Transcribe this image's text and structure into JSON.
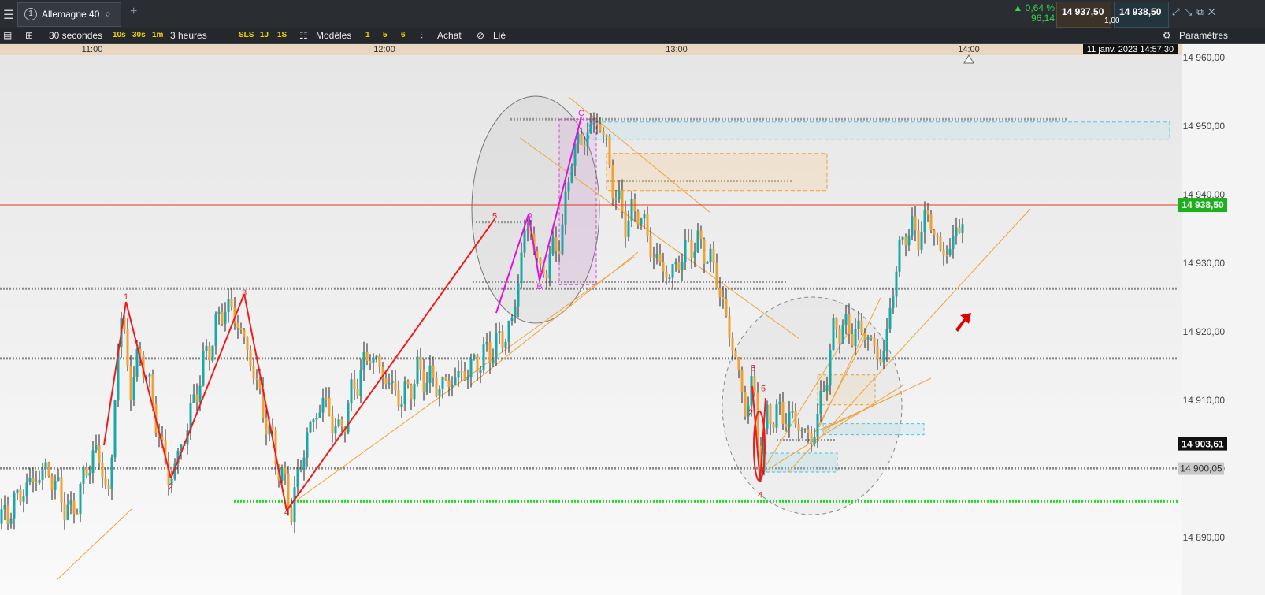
{
  "topbar": {
    "instrument": "Allemagne 40",
    "tab_number": "1",
    "change_pct": "0,64 %",
    "change_abs": "96,14",
    "bid": "14 937,50",
    "ask": "14 938,50",
    "spread": "1,00",
    "accent_green": "#35d24a"
  },
  "toolbar": {
    "interval": "30 secondes",
    "quick_intervals": [
      "10s",
      "30s",
      "1m"
    ],
    "range": "3 heures",
    "range_buttons": [
      "SLS",
      "1J",
      "1S"
    ],
    "templates_label": "Modèles",
    "template_slots": [
      "1",
      "5",
      "6"
    ],
    "buy_label": "Achat",
    "linked_label": "Lié",
    "settings_label": "Paramètres"
  },
  "chart_data": {
    "type": "candlestick",
    "instrument": "Allemagne 40",
    "x_ticks": [
      "11:00",
      "12:00",
      "13:00",
      "14:00"
    ],
    "y_ticks": [
      "14 960,00",
      "14 950,00",
      "14 940,00",
      "14 930,00",
      "14 920,00",
      "14 910,00",
      "14 900,00",
      "14 890,00"
    ],
    "ylim": [
      14885,
      14963
    ],
    "timestamp_label": "11 janv. 2023 14:57:30",
    "last_price_label": "14 938,50",
    "last_price": 14938.5,
    "marker_label_1": "14 903,61",
    "marker_1": 14903.61,
    "marker_label_2": "14 900,05",
    "marker_2": 14900.05,
    "close_path": [
      [
        0,
        14892
      ],
      [
        30,
        14897
      ],
      [
        60,
        14900
      ],
      [
        90,
        14893
      ],
      [
        120,
        14903
      ],
      [
        140,
        14896
      ],
      [
        152,
        14924
      ],
      [
        165,
        14912
      ],
      [
        180,
        14917
      ],
      [
        200,
        14906
      ],
      [
        215,
        14898
      ],
      [
        235,
        14905
      ],
      [
        260,
        14916
      ],
      [
        285,
        14924
      ],
      [
        300,
        14922
      ],
      [
        320,
        14915
      ],
      [
        335,
        14908
      ],
      [
        355,
        14900
      ],
      [
        370,
        14894
      ],
      [
        390,
        14905
      ],
      [
        410,
        14910
      ],
      [
        430,
        14905
      ],
      [
        450,
        14912
      ],
      [
        470,
        14917
      ],
      [
        490,
        14913
      ],
      [
        510,
        14910
      ],
      [
        530,
        14914
      ],
      [
        560,
        14912
      ],
      [
        590,
        14914
      ],
      [
        610,
        14916
      ],
      [
        630,
        14918
      ],
      [
        650,
        14921
      ],
      [
        665,
        14934
      ],
      [
        675,
        14935
      ],
      [
        685,
        14928
      ],
      [
        700,
        14931
      ],
      [
        715,
        14935
      ],
      [
        725,
        14946
      ],
      [
        740,
        14948
      ],
      [
        760,
        14951
      ],
      [
        770,
        14947
      ],
      [
        780,
        14940
      ],
      [
        795,
        14936
      ],
      [
        810,
        14938
      ],
      [
        830,
        14931
      ],
      [
        850,
        14928
      ],
      [
        865,
        14931
      ],
      [
        880,
        14933
      ],
      [
        895,
        14932
      ],
      [
        910,
        14928
      ],
      [
        925,
        14920
      ],
      [
        935,
        14916
      ],
      [
        945,
        14908
      ],
      [
        955,
        14913
      ],
      [
        965,
        14901
      ],
      [
        975,
        14908
      ],
      [
        990,
        14908
      ],
      [
        1010,
        14907
      ],
      [
        1030,
        14904
      ],
      [
        1045,
        14911
      ],
      [
        1060,
        14921
      ],
      [
        1080,
        14920
      ],
      [
        1100,
        14920
      ],
      [
        1115,
        14916
      ],
      [
        1125,
        14918
      ],
      [
        1135,
        14928
      ],
      [
        1150,
        14935
      ],
      [
        1165,
        14934
      ],
      [
        1180,
        14937
      ],
      [
        1195,
        14931
      ],
      [
        1210,
        14933
      ],
      [
        1225,
        14938
      ]
    ],
    "dotted_levels": [
      14926.3,
      14916.1,
      14900.1
    ],
    "support_level": 14895.3,
    "wave_labels": [
      {
        "t": "1",
        "x": 160,
        "p": 14924.7
      },
      {
        "t": "2",
        "x": 217,
        "p": 14897
      },
      {
        "t": "3",
        "x": 310,
        "p": 14925.3
      },
      {
        "t": "4",
        "x": 364,
        "p": 14893.3
      },
      {
        "t": "5",
        "x": 628,
        "p": 14936.5
      },
      {
        "t": "A",
        "x": 673,
        "p": 14936.5
      },
      {
        "t": "B",
        "x": 685,
        "p": 14926.2
      },
      {
        "t": "C",
        "x": 738,
        "p": 14951.5
      },
      {
        "t": "3",
        "x": 956,
        "p": 14914.3
      },
      {
        "t": "5",
        "x": 969,
        "p": 14911.3
      },
      {
        "t": "2",
        "x": 953,
        "p": 14907.8
      },
      {
        "t": "4",
        "x": 965,
        "p": 14895.8
      }
    ],
    "grid": false
  }
}
